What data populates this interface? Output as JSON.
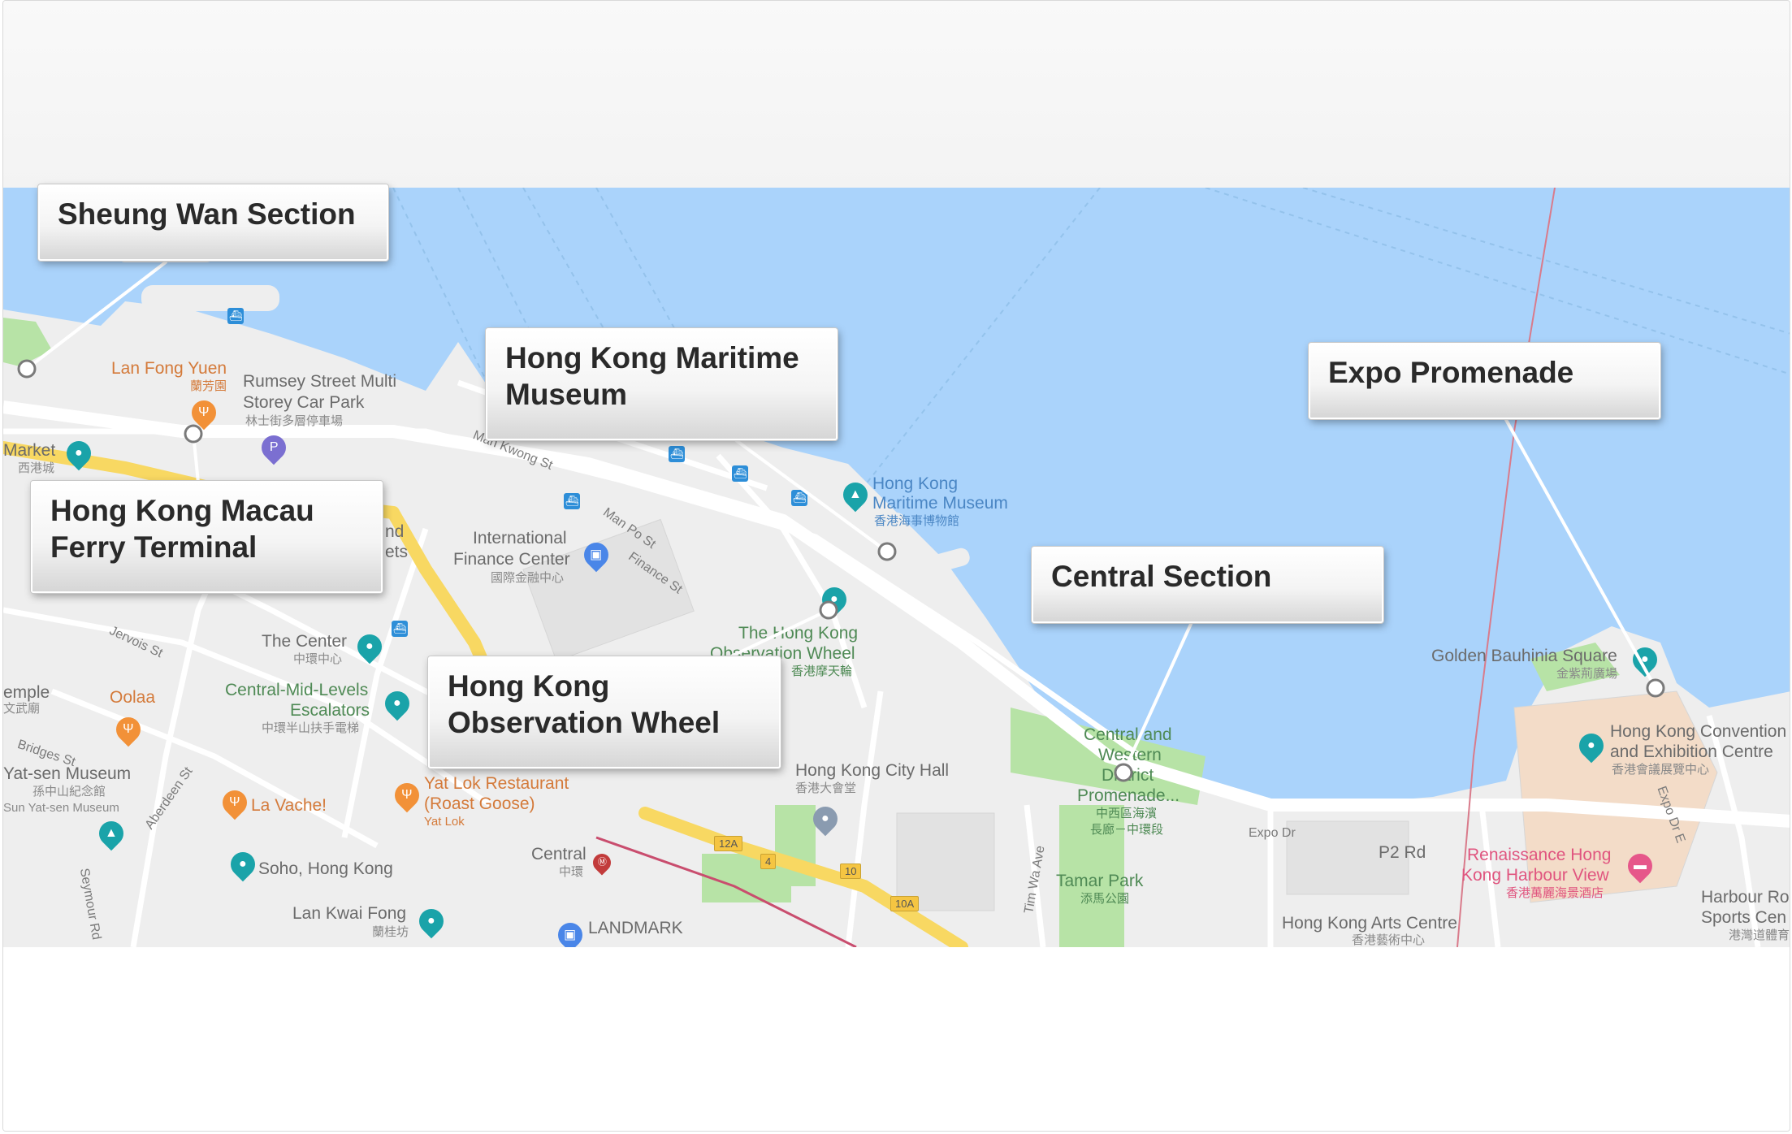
{
  "map": {
    "labels": {
      "lan_fong_yuen": "Lan Fong Yuen",
      "lan_fong_yuen_cn": "蘭芳園",
      "rumsey_1": "Rumsey Street Multi",
      "rumsey_2": "Storey Car Park",
      "rumsey_cn": "林士街多層停車場",
      "market": "Market",
      "market_cn": "西港城",
      "hk_maritime_1": "Hong Kong",
      "hk_maritime_2": "Maritime Museum",
      "hk_maritime_cn": "香港海事博物館",
      "ifc_1": "International",
      "ifc_2": "Finance Center",
      "ifc_cn": "國際金融中心",
      "man_kwong_st": "Man Kwong St",
      "man_po_st": "Man Po St",
      "finance_st": "Finance St",
      "the_center": "The Center",
      "the_center_cn": "中環中心",
      "jervois_st": "Jervois St",
      "central_mid_1": "Central-Mid-Levels",
      "central_mid_2": "Escalators",
      "central_mid_cn": "中環半山扶手電梯",
      "temple": "emple",
      "temple_cn": "文武廟",
      "oolaa": "Oolaa",
      "bridges_st": "Bridges St",
      "yat_sen_1": "Yat-sen Museum",
      "yat_sen_cn": "孫中山紀念館",
      "yat_sen_2": "Sun Yat-sen Museum",
      "aberdeen_st": "Aberdeen St",
      "la_vache": "La Vache!",
      "yat_lok_1": "Yat Lok Restaurant",
      "yat_lok_2": "(Roast Goose)",
      "yat_lok_3": "Yat Lok",
      "soho": "Soho, Hong Kong",
      "lan_kwai_fong": "Lan Kwai Fong",
      "lan_kwai_fong_cn": "蘭桂坊",
      "seymour_rd": "Seymour Rd",
      "central": "Central",
      "central_cn": "中環",
      "landmark": "LANDMARK",
      "obs_wheel_1": "The Hong Kong",
      "obs_wheel_2": "Observation Wheel",
      "obs_wheel_cn": "香港摩天輪",
      "city_hall": "Hong Kong City Hall",
      "city_hall_cn": "香港大會堂",
      "cw_promenade_1": "Central and",
      "cw_promenade_2": "Western",
      "cw_promenade_3": "District",
      "cw_promenade_4": "Promenade...",
      "cw_promenade_cn1": "中西區海濱",
      "cw_promenade_cn2": "長廊－中環段",
      "tim_wa_ave": "Tim Wa Ave",
      "tamar_park": "Tamar Park",
      "tamar_park_cn": "添馬公園",
      "expo_dr": "Expo Dr",
      "p2_rd": "P2 Rd",
      "golden_bauhinia": "Golden Bauhinia Square",
      "golden_bauhinia_cn": "金紫荊廣場",
      "hkcec_1": "Hong Kong Convention",
      "hkcec_2": "and Exhibition Centre",
      "hkcec_cn": "香港會議展覽中心",
      "expo_dr_e": "Expo Dr E",
      "renaissance_1": "Renaissance Hong",
      "renaissance_2": "Kong Harbour View",
      "renaissance_cn": "香港萬麗海景酒店",
      "arts_centre": "Hong Kong Arts Centre",
      "arts_centre_cn": "香港藝術中心",
      "harbour_road_1": "Harbour Ro",
      "harbour_road_2": "Sports Cen",
      "harbour_road_cn": "港灣道體育",
      "nd": "nd",
      "ets": "ets"
    },
    "road_shields": [
      "12A",
      "4",
      "10",
      "10A"
    ],
    "colors": {
      "water": "#aad3fb",
      "land": "#eeeeee",
      "major_road": "#f8d862",
      "park": "#b7e3a6"
    }
  },
  "callouts": [
    {
      "id": "sheung-wan",
      "label": "Sheung Wan Section"
    },
    {
      "id": "hk-macau-ferry",
      "label": "Hong Kong Macau Ferry Terminal"
    },
    {
      "id": "hk-maritime-museum",
      "label": "Hong Kong Maritime Museum"
    },
    {
      "id": "hk-observation-wheel",
      "label": "Hong Kong Observation Wheel"
    },
    {
      "id": "central-section",
      "label": "Central Section"
    },
    {
      "id": "expo-promenade",
      "label": "Expo Promenade"
    }
  ]
}
